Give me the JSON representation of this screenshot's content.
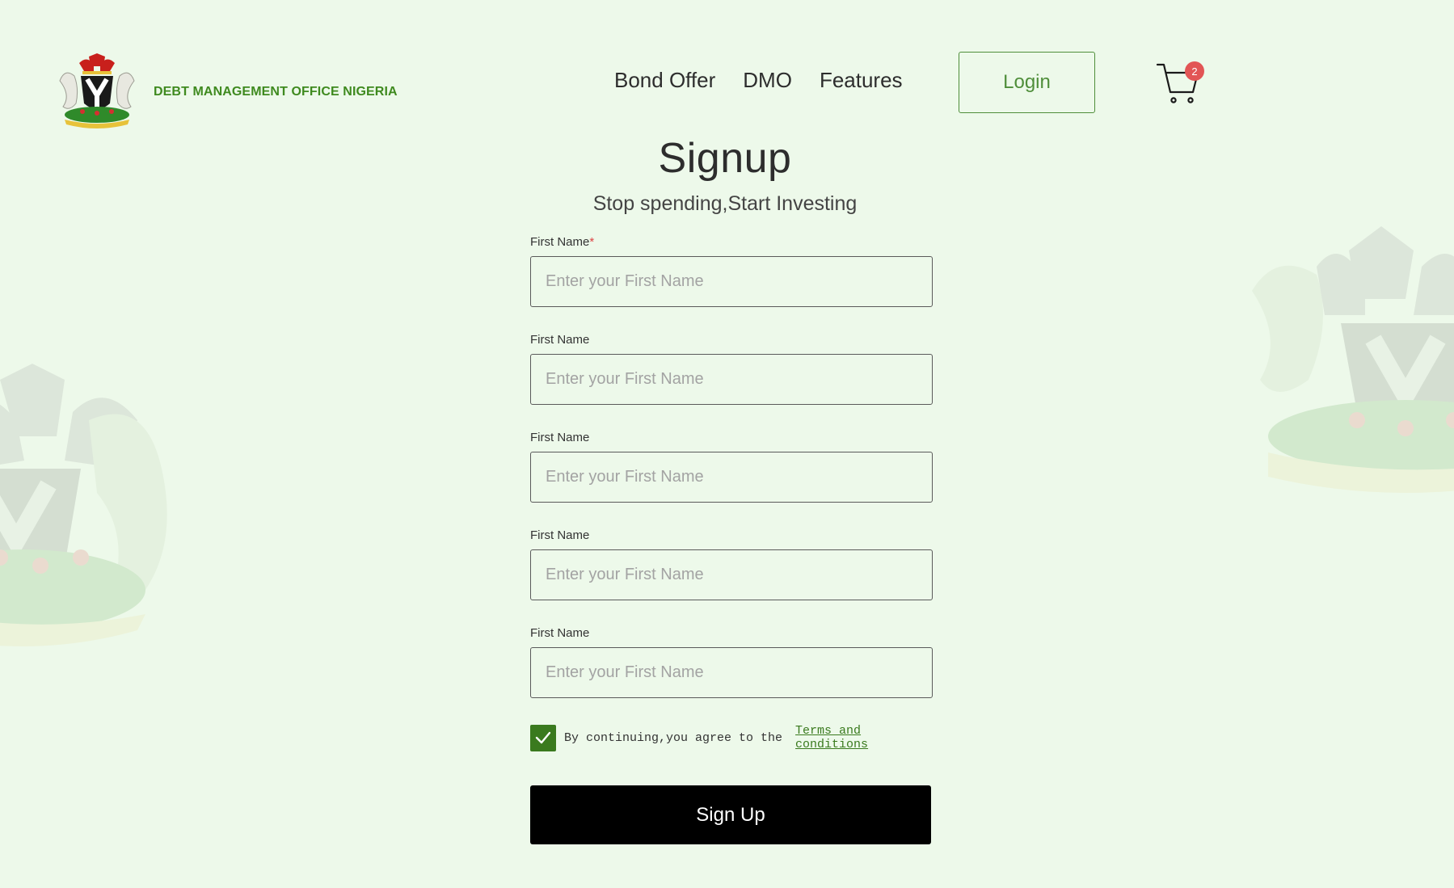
{
  "brand": {
    "name": "DEBT MANAGEMENT OFFICE NIGERIA"
  },
  "nav": {
    "items": [
      "Bond Offer",
      "DMO",
      "Features"
    ],
    "login_label": "Login"
  },
  "cart": {
    "count": "2",
    "icon": "cart-icon"
  },
  "page": {
    "title": "Signup",
    "subtitle": "Stop spending,Start Investing"
  },
  "form": {
    "fields": [
      {
        "label": "First Name",
        "required": "*",
        "placeholder": "Enter your First Name",
        "value": ""
      },
      {
        "label": "First Name",
        "placeholder": "Enter your First Name",
        "value": ""
      },
      {
        "label": "First Name",
        "placeholder": "Enter your First Name",
        "value": ""
      },
      {
        "label": "First Name",
        "placeholder": "Enter your First Name",
        "value": ""
      },
      {
        "label": "First Name",
        "placeholder": "Enter your First Name",
        "value": ""
      }
    ],
    "terms_checked": true,
    "terms_text": "By continuing,you agree to the",
    "terms_link": "Terms and conditions",
    "submit_label": "Sign Up"
  },
  "colors": {
    "background": "#edf9ea",
    "brand_green": "#3f8a1f",
    "accent_green": "#4f8e3a",
    "checkbox_green": "#3a7a1e",
    "badge_red": "#e25555",
    "button_black": "#000000"
  }
}
